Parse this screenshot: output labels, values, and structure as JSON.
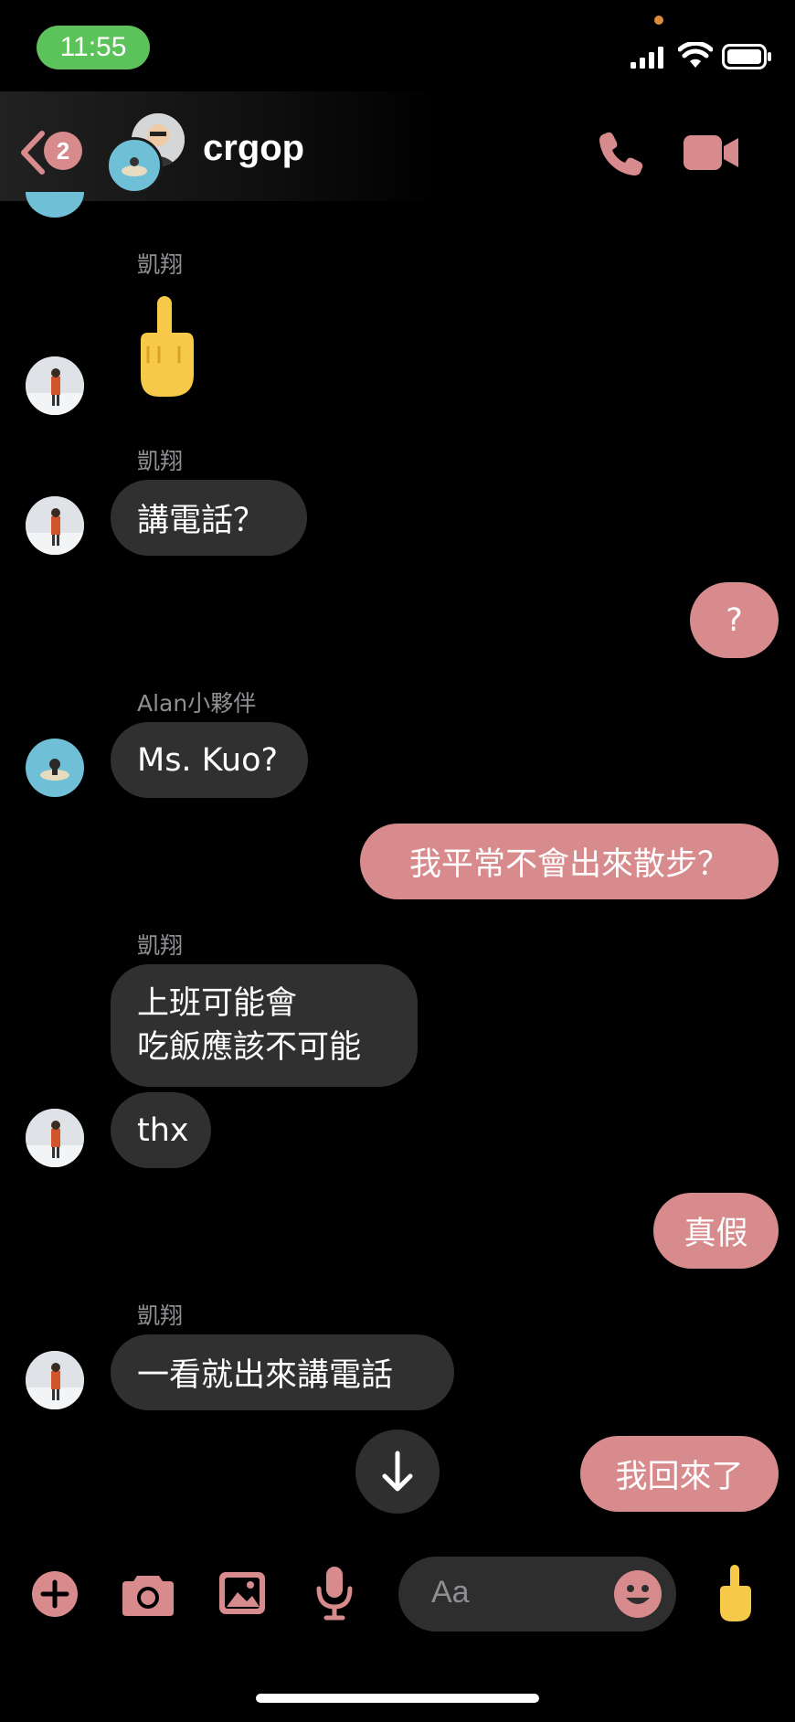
{
  "status_bar": {
    "time": "11:55"
  },
  "header": {
    "back_badge": "2",
    "title": "crgop"
  },
  "messages": {
    "s1": "凱翔",
    "s2": "凱翔",
    "b2": "講電話？",
    "o1": "?",
    "s3": "Alan小夥伴",
    "b3": "Ms. Kuo?",
    "o2": "我平常不會出來散步？",
    "s4": "凱翔",
    "b4_line1": "上班可能會",
    "b4_line2": "吃飯應該不可能",
    "b5": "thx",
    "o3": "真假",
    "s5": "凱翔",
    "b6": "一看就出來講電話",
    "o4": "我回來了"
  },
  "composer": {
    "placeholder": "Aa"
  },
  "colors": {
    "accent": "#d88b8d",
    "incoming_bubble": "#303030",
    "status_pill": "#5cc25a"
  },
  "icons": [
    "back-chevron-icon",
    "phone-icon",
    "video-camera-icon",
    "middle-finger-emoji-icon",
    "arrow-down-icon",
    "plus-icon",
    "camera-icon",
    "image-icon",
    "microphone-icon",
    "emoji-icon"
  ]
}
